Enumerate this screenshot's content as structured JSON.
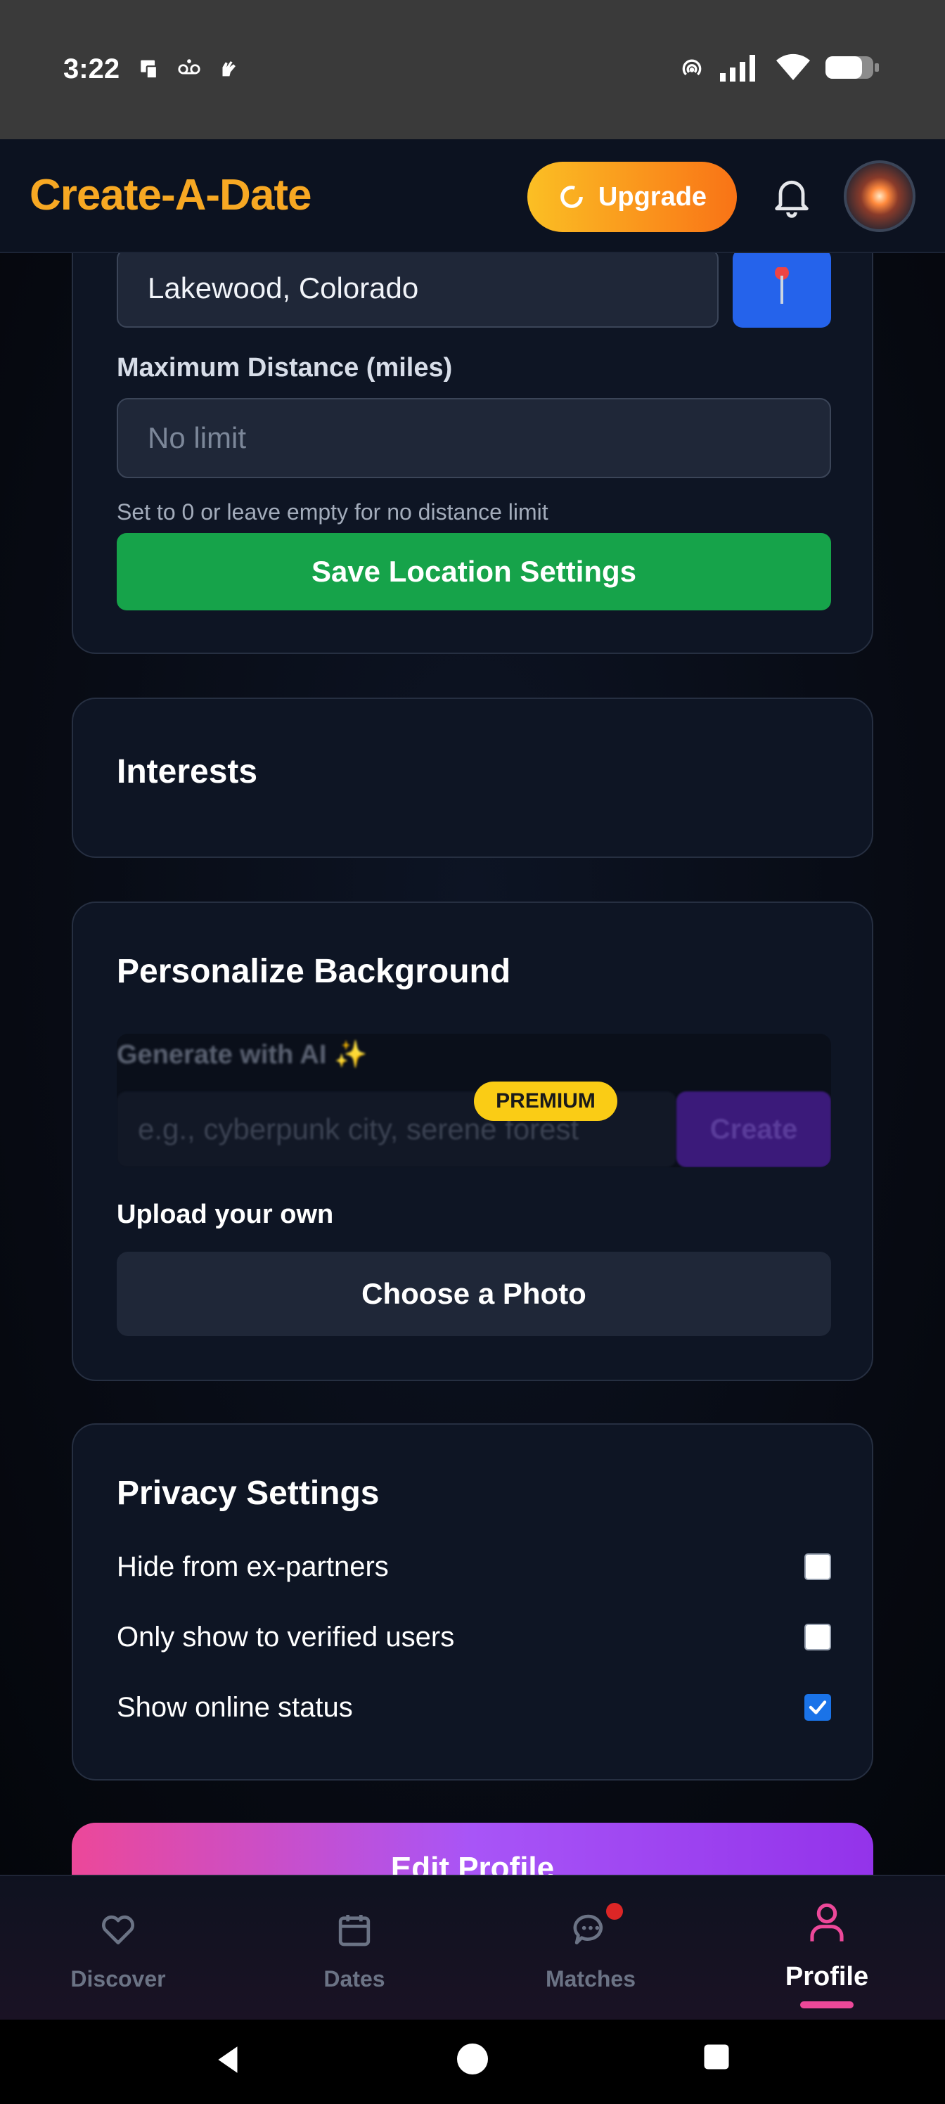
{
  "status_bar": {
    "time": "3:22"
  },
  "header": {
    "app_title": "Create-A-Date",
    "upgrade_label": "Upgrade"
  },
  "location_card": {
    "location_value": "Lakewood, Colorado",
    "distance_label": "Maximum Distance (miles)",
    "distance_placeholder": "No limit",
    "distance_hint": "Set to 0 or leave empty for no distance limit",
    "save_label": "Save Location Settings"
  },
  "interests_card": {
    "title": "Interests"
  },
  "background_card": {
    "title": "Personalize Background",
    "ai_label": "Generate with AI ✨",
    "ai_placeholder": "e.g., cyberpunk city, serene forest",
    "ai_create_label": "Create",
    "premium_badge": "PREMIUM",
    "upload_label": "Upload your own",
    "choose_label": "Choose a Photo"
  },
  "privacy_card": {
    "title": "Privacy Settings",
    "options": [
      {
        "label": "Hide from ex-partners",
        "checked": false
      },
      {
        "label": "Only show to verified users",
        "checked": false
      },
      {
        "label": "Show online status",
        "checked": true
      }
    ]
  },
  "edit_profile_label": "Edit Profile",
  "bottom_nav": {
    "items": [
      {
        "label": "Discover",
        "icon": "heart-icon",
        "active": false
      },
      {
        "label": "Dates",
        "icon": "calendar-icon",
        "active": false
      },
      {
        "label": "Matches",
        "icon": "chat-icon",
        "active": false,
        "notification_dot": true
      },
      {
        "label": "Profile",
        "icon": "user-icon",
        "active": true
      }
    ]
  },
  "colors": {
    "brand": "#f7a823",
    "save_button": "#16a34a",
    "premium": "#facc15",
    "active_nav": "#ec4899",
    "checkbox_checked": "#1a73e8"
  }
}
